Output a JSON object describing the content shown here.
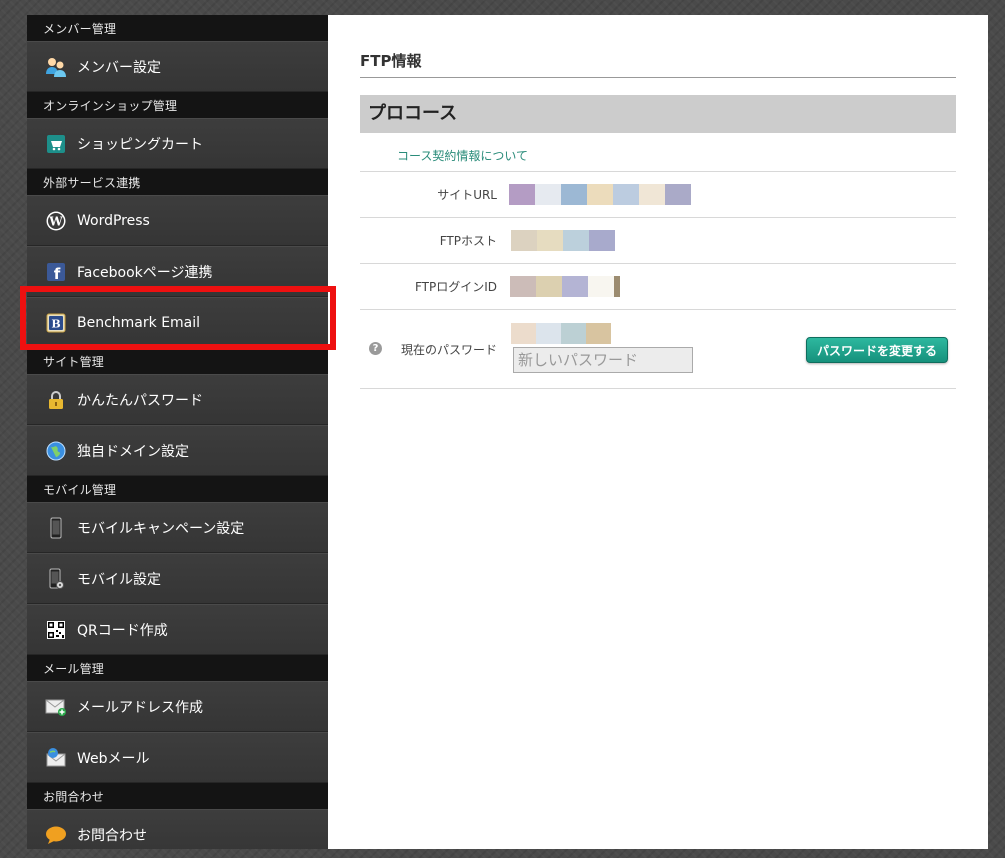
{
  "sidebar": {
    "sections": [
      {
        "header": "メンバー管理",
        "items": [
          {
            "label": "メンバー設定",
            "icon": "members-icon"
          }
        ]
      },
      {
        "header": "オンラインショップ管理",
        "items": [
          {
            "label": "ショッピングカート",
            "icon": "cart-icon"
          }
        ]
      },
      {
        "header": "外部サービス連携",
        "items": [
          {
            "label": "WordPress",
            "icon": "wordpress-icon"
          },
          {
            "label": "Facebookページ連携",
            "icon": "facebook-icon"
          },
          {
            "label": "Benchmark Email",
            "icon": "benchmark-icon"
          }
        ]
      },
      {
        "header": "サイト管理",
        "items": [
          {
            "label": "かんたんパスワード",
            "icon": "lock-icon"
          },
          {
            "label": "独自ドメイン設定",
            "icon": "globe-icon"
          }
        ]
      },
      {
        "header": "モバイル管理",
        "items": [
          {
            "label": "モバイルキャンペーン設定",
            "icon": "mobile-icon"
          },
          {
            "label": "モバイル設定",
            "icon": "mobile-settings-icon"
          },
          {
            "label": "QRコード作成",
            "icon": "qrcode-icon"
          }
        ]
      },
      {
        "header": "メール管理",
        "items": [
          {
            "label": "メールアドレス作成",
            "icon": "mail-add-icon"
          },
          {
            "label": "Webメール",
            "icon": "webmail-icon"
          }
        ]
      },
      {
        "header": "お問合わせ",
        "items": [
          {
            "label": "お問合わせ",
            "icon": "chat-bubble-icon"
          }
        ]
      }
    ]
  },
  "main": {
    "title": "FTP情報",
    "course_title": "プロコース",
    "course_link": "コース契約情報について",
    "rows": {
      "site_url": {
        "label": "サイトURL",
        "blocks": [
          "#b49cc4",
          "#e6eaf0",
          "#9cb8d4",
          "#ecdcbc",
          "#bccce0",
          "#f0e6d6",
          "#aaaac8"
        ]
      },
      "ftp_host": {
        "label": "FTPホスト",
        "blocks": [
          "#dcd2c0",
          "#e6dcc0",
          "#bcd0dc",
          "#a8aacc"
        ]
      },
      "ftp_login": {
        "label": "FTPログインID",
        "blocks": [
          "#ccbcb8",
          "#dcd0b0",
          "#b4b4d4",
          "#f8f6f0",
          "#9c8c70"
        ]
      },
      "password": {
        "label": "現在のパスワード",
        "blocks": [
          "#ecdccc",
          "#dce4ec",
          "#bcd0d4",
          "#d8c4a0"
        ],
        "placeholder": "新しいパスワード",
        "button": "パスワードを変更する"
      }
    }
  },
  "colors": {
    "accent": "#1a9a84",
    "link": "#2a8c7a",
    "highlight": "#ee1010"
  }
}
